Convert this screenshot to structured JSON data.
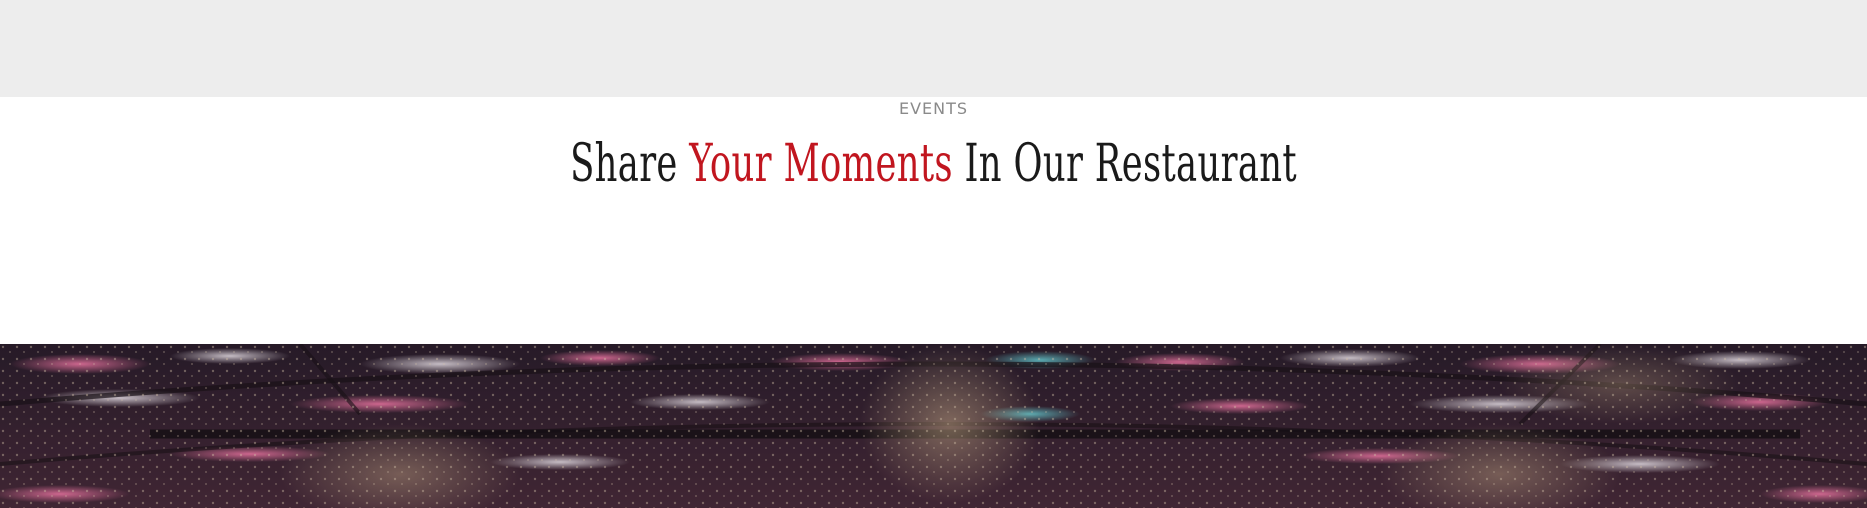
{
  "events": {
    "eyebrow": "EVENTS",
    "heading": {
      "part1": "Share",
      "accent": "Your Moments",
      "part2": "In Our Restaurant"
    },
    "accent_color": "#c1161f"
  },
  "hero": {
    "image": "restaurant-ceiling-lights-photo"
  }
}
